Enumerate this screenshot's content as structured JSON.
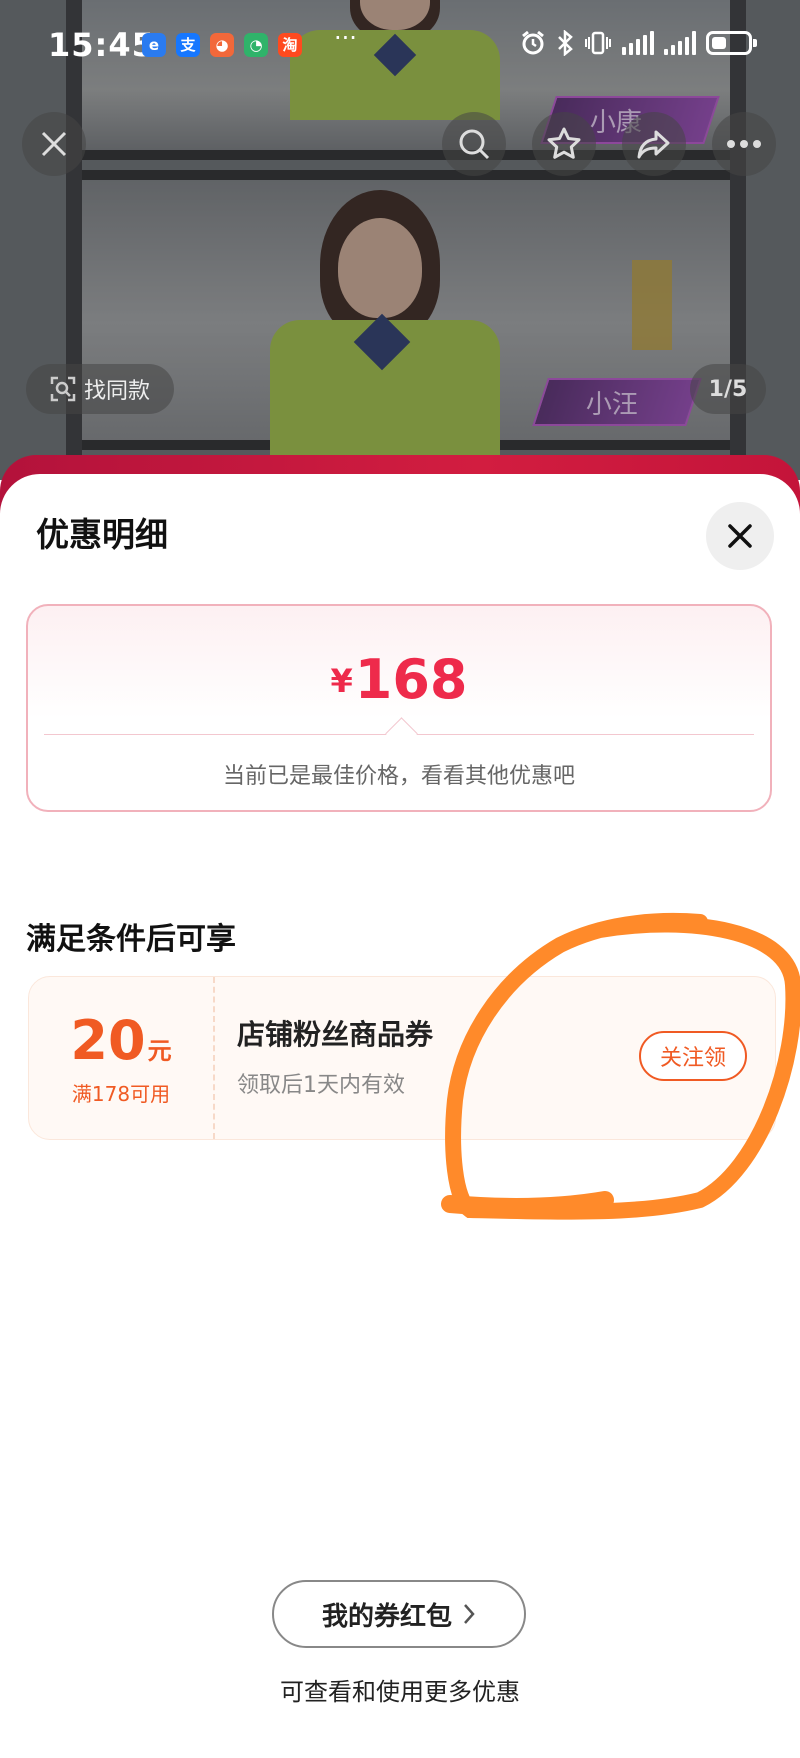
{
  "status_bar": {
    "time": "15:45",
    "app_icons": [
      {
        "icon": "app-blue-icon",
        "glyph": "e",
        "color": "#2a7bf0"
      },
      {
        "icon": "alipay-icon",
        "glyph": "支",
        "color": "#1677ff"
      },
      {
        "icon": "app-orange-icon",
        "glyph": "◕",
        "color": "#f2683a"
      },
      {
        "icon": "message-icon",
        "glyph": "◔",
        "color": "#2fb36a"
      },
      {
        "icon": "taobao-icon",
        "glyph": "淘",
        "color": "#ff4a1f"
      }
    ],
    "more": "···"
  },
  "top_bar": {
    "find_same_label": "找同款",
    "pager": "1/5",
    "name_tags": [
      "小康",
      "小汪"
    ]
  },
  "sheet": {
    "title": "优惠明细",
    "price": {
      "currency": "¥",
      "amount": "168",
      "note": "当前已是最佳价格，看看其他优惠吧"
    },
    "section_title": "满足条件后可享",
    "coupon": {
      "amount": "20",
      "unit": "元",
      "condition": "满178可用",
      "name": "店铺粉丝商品券",
      "validity": "领取后1天内有效",
      "action_label": "关注领"
    },
    "my_coupons_label": "我的券红包",
    "more_note": "可查看和使用更多优惠"
  },
  "colors": {
    "accent_red": "#ee2a4b",
    "coupon_orange": "#f05a23",
    "annotation_orange": "#ff8a2a"
  }
}
